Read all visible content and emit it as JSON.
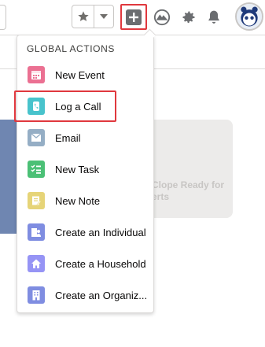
{
  "colors": {
    "highlight": "#e0383e",
    "new_event": "#eb7092",
    "log_a_call": "#48c3cc",
    "email": "#95aec5",
    "new_task": "#4bc076",
    "new_note": "#e6d478",
    "create_individual": "#7f8de1",
    "create_household": "#9694f5",
    "create_organization": "#7f8de1"
  },
  "header": {
    "icons": [
      "star-icon",
      "chevron-down-icon",
      "add-icon",
      "trailhead-icon",
      "gear-icon",
      "bell-icon",
      "avatar"
    ]
  },
  "background": {
    "card_text": "Clope Ready for erts"
  },
  "global_actions": {
    "heading": "GLOBAL ACTIONS",
    "items": [
      {
        "label": "New Event",
        "icon": "calendar-icon"
      },
      {
        "label": "Log a Call",
        "icon": "phone-icon"
      },
      {
        "label": "Email",
        "icon": "email-icon"
      },
      {
        "label": "New Task",
        "icon": "task-icon"
      },
      {
        "label": "New Note",
        "icon": "note-icon"
      },
      {
        "label": "Create an Individual",
        "icon": "individual-icon"
      },
      {
        "label": "Create a Household",
        "icon": "household-icon"
      },
      {
        "label": "Create an Organiz...",
        "icon": "organization-icon"
      }
    ]
  }
}
